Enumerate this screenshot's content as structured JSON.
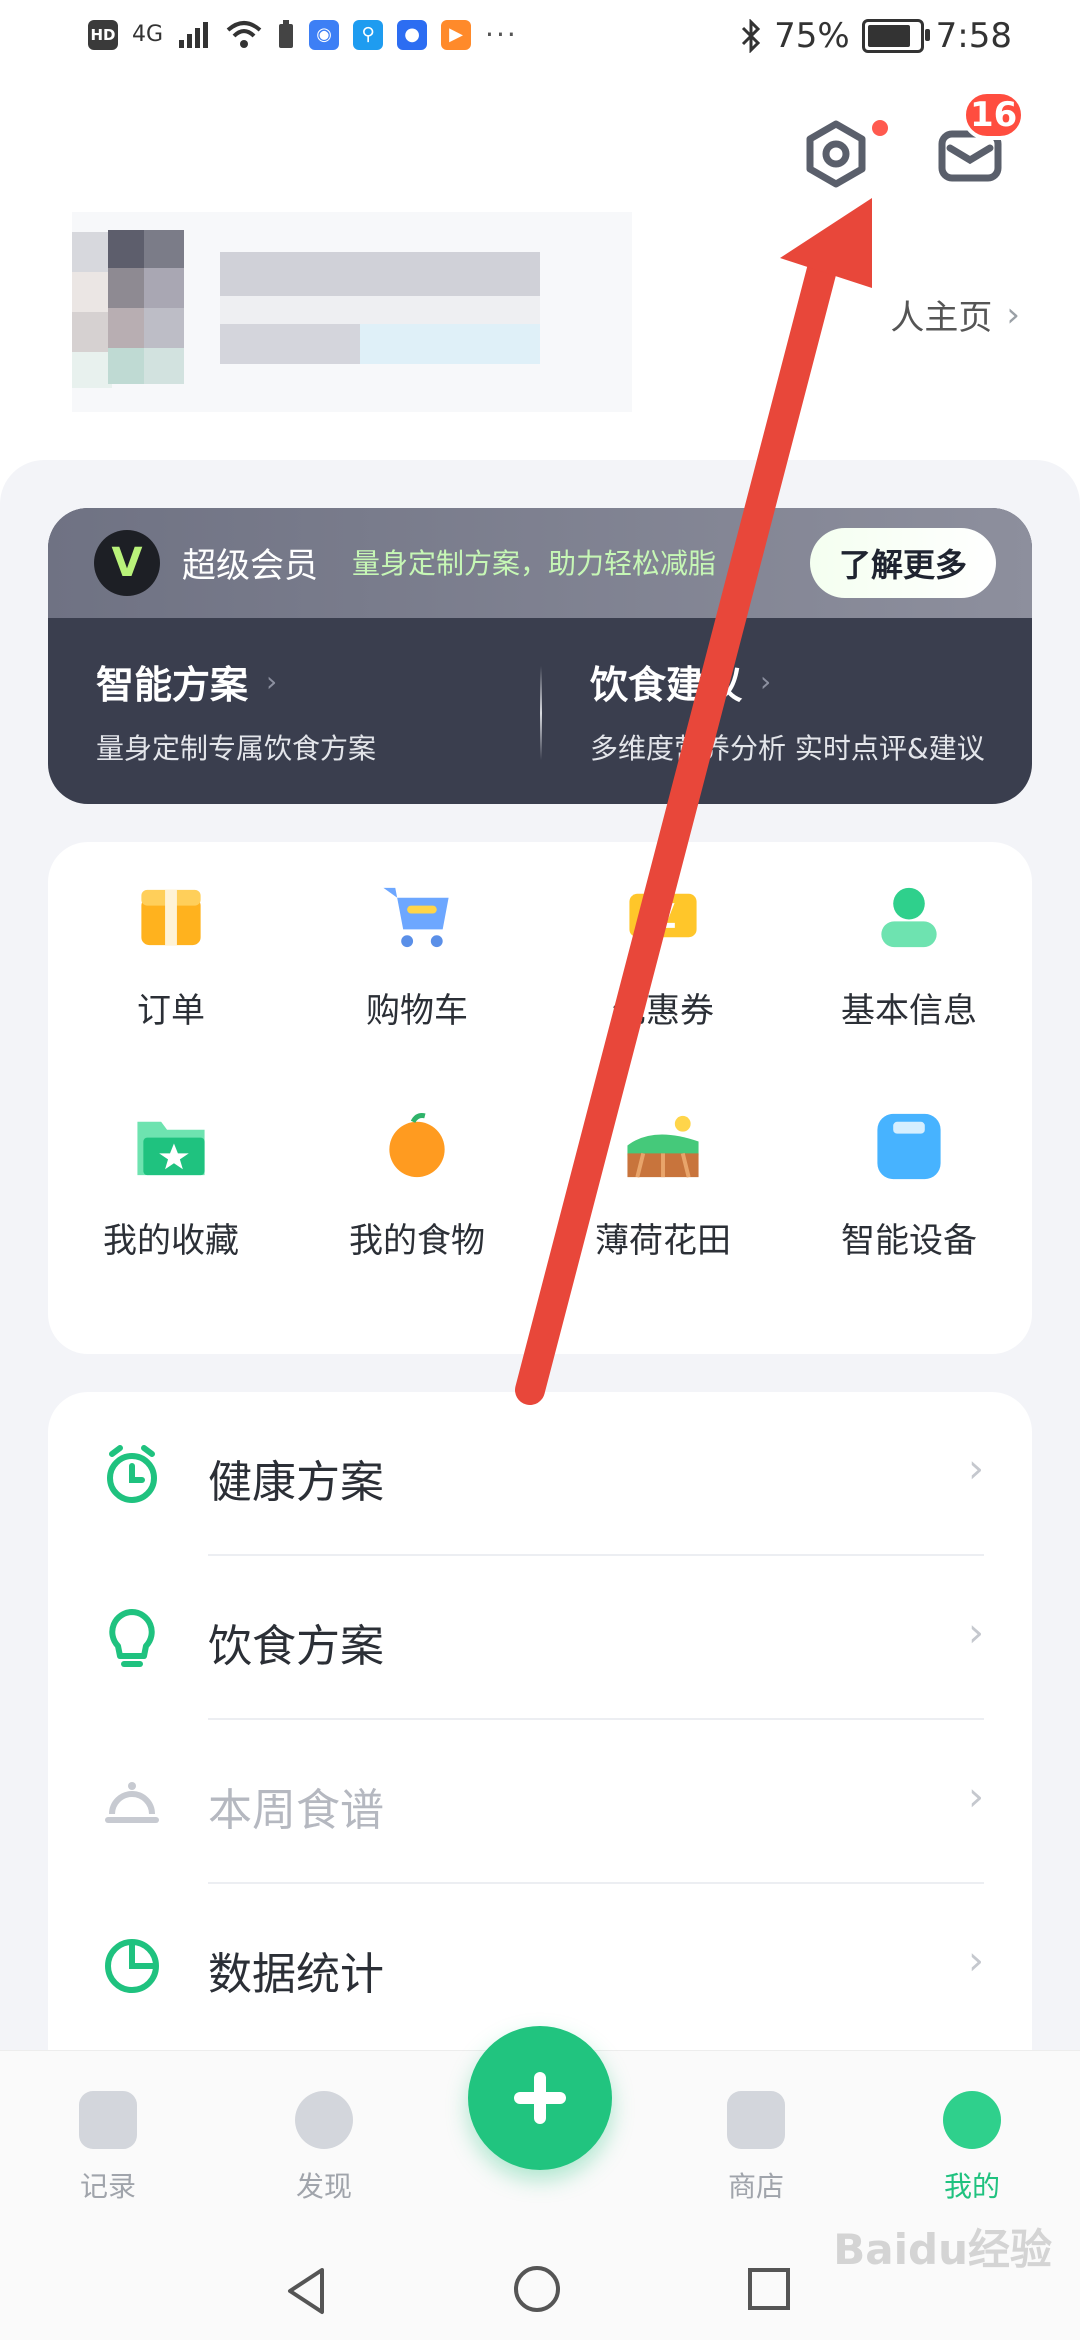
{
  "status_bar": {
    "left_indicators": [
      "HD",
      "4G"
    ],
    "dots": "···",
    "battery": "75%",
    "battery_level": 0.75,
    "time": "7:58"
  },
  "header": {
    "mail_badge": "16",
    "profile_link": "人主页"
  },
  "vip": {
    "logo": "V",
    "title": "超级会员",
    "slogan": "量身定制方案，助力轻松减脂",
    "more_button": "了解更多",
    "left": {
      "title": "智能方案",
      "subtitle": "量身定制专属饮食方案"
    },
    "right": {
      "title": "饮食建议",
      "subtitle": "多维度营养分析 实时点评&建议"
    }
  },
  "grid": {
    "items": [
      {
        "label": "订单",
        "icon": "package-icon"
      },
      {
        "label": "购物车",
        "icon": "cart-icon"
      },
      {
        "label": "优惠券",
        "icon": "coupon-icon"
      },
      {
        "label": "基本信息",
        "icon": "user-icon"
      },
      {
        "label": "我的收藏",
        "icon": "folder-star-icon"
      },
      {
        "label": "我的食物",
        "icon": "orange-icon"
      },
      {
        "label": "薄荷花田",
        "icon": "field-icon"
      },
      {
        "label": "智能设备",
        "icon": "scale-icon"
      }
    ]
  },
  "list": {
    "items": [
      {
        "label": "健康方案",
        "icon": "timer-icon",
        "enabled": true
      },
      {
        "label": "饮食方案",
        "icon": "bulb-icon",
        "enabled": true
      },
      {
        "label": "本周食谱",
        "icon": "cloche-icon",
        "enabled": false
      },
      {
        "label": "数据统计",
        "icon": "pie-chart-icon",
        "enabled": true
      }
    ]
  },
  "tabs": {
    "items": [
      {
        "label": "记录",
        "active": false
      },
      {
        "label": "发现",
        "active": false
      },
      {
        "label": "商店",
        "active": false
      },
      {
        "label": "我的",
        "active": true
      }
    ]
  },
  "watermark": "Baidu经验",
  "colors": {
    "accent": "#21c47f",
    "badge": "#ff4d3f",
    "vip_bg": "#3a3e4e",
    "annotation_arrow": "#e8473a"
  }
}
